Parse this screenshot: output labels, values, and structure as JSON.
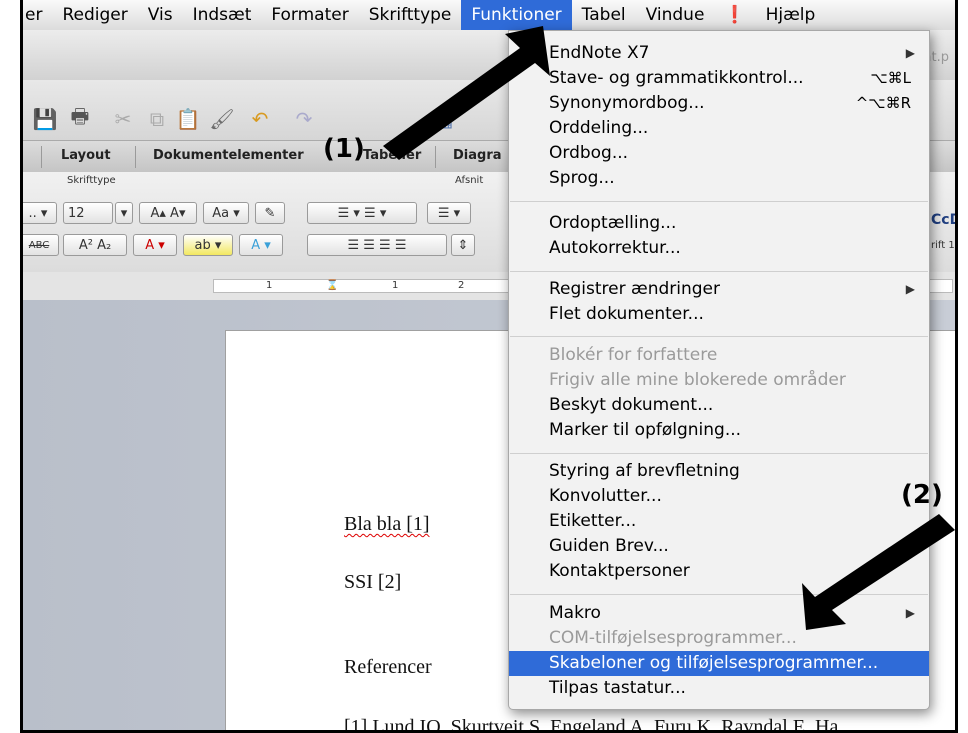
{
  "menubar": {
    "items": [
      "er",
      "Rediger",
      "Vis",
      "Indsæt",
      "Formater",
      "Skrifttype",
      "Funktioner",
      "Tabel",
      "Vindue",
      "Hjælp"
    ],
    "script_icon": "script-menu-icon"
  },
  "window": {
    "filename_partial": "at.p"
  },
  "ribbon": {
    "tabs": [
      "Layout",
      "Dokumentelementer",
      "Tabeller",
      "Diagra"
    ],
    "groups": [
      "Skrifttype",
      "Afsnit"
    ],
    "font_size": "12",
    "style_preview": "CcD",
    "style_name": "rift 1"
  },
  "ruler": {
    "marks": [
      "1",
      "1",
      "2"
    ]
  },
  "document": {
    "lines": [
      "Bla bla [1]",
      "SSI [2]",
      "Referencer",
      "[1] Lund IO, Skurtveit S, Engeland A, Furu K, Ravndal E, Ha"
    ]
  },
  "menu": {
    "title": "Funktioner",
    "items": [
      {
        "label": "EndNote X7",
        "shortcut": "",
        "submenu": true,
        "enabled": true
      },
      {
        "label": "Stave- og grammatikkontrol...",
        "shortcut": "⌥⌘L",
        "submenu": false,
        "enabled": true
      },
      {
        "label": "Synonymordbog...",
        "shortcut": "^⌥⌘R",
        "submenu": false,
        "enabled": true
      },
      {
        "label": "Orddeling...",
        "shortcut": "",
        "submenu": false,
        "enabled": true
      },
      {
        "label": "Ordbog...",
        "shortcut": "",
        "submenu": false,
        "enabled": true
      },
      {
        "label": "Sprog...",
        "shortcut": "",
        "submenu": false,
        "enabled": true
      },
      {
        "label": "Ordoptælling...",
        "shortcut": "",
        "submenu": false,
        "enabled": true
      },
      {
        "label": "Autokorrektur...",
        "shortcut": "",
        "submenu": false,
        "enabled": true
      },
      {
        "label": "Registrer ændringer",
        "shortcut": "",
        "submenu": true,
        "enabled": true
      },
      {
        "label": "Flet dokumenter...",
        "shortcut": "",
        "submenu": false,
        "enabled": true
      },
      {
        "label": "Blokér for forfattere",
        "shortcut": "",
        "submenu": false,
        "enabled": false
      },
      {
        "label": "Frigiv alle mine blokerede områder",
        "shortcut": "",
        "submenu": false,
        "enabled": false
      },
      {
        "label": "Beskyt dokument...",
        "shortcut": "",
        "submenu": false,
        "enabled": true
      },
      {
        "label": "Marker til opfølgning...",
        "shortcut": "",
        "submenu": false,
        "enabled": true
      },
      {
        "label": "Styring af brevfletning",
        "shortcut": "",
        "submenu": false,
        "enabled": true
      },
      {
        "label": "Konvolutter...",
        "shortcut": "",
        "submenu": false,
        "enabled": true
      },
      {
        "label": "Etiketter...",
        "shortcut": "",
        "submenu": false,
        "enabled": true
      },
      {
        "label": "Guiden Brev...",
        "shortcut": "",
        "submenu": false,
        "enabled": true
      },
      {
        "label": "Kontaktpersoner",
        "shortcut": "",
        "submenu": false,
        "enabled": true
      },
      {
        "label": "Makro",
        "shortcut": "",
        "submenu": true,
        "enabled": true
      },
      {
        "label": "COM-tilføjelsesprogrammer...",
        "shortcut": "",
        "submenu": false,
        "enabled": false
      },
      {
        "label": "Skabeloner og tilføjelsesprogrammer...",
        "shortcut": "",
        "submenu": false,
        "enabled": true,
        "highlighted": true
      },
      {
        "label": "Tilpas tastatur...",
        "shortcut": "",
        "submenu": false,
        "enabled": true
      }
    ]
  },
  "annotations": [
    "(1)",
    "(2)"
  ],
  "colors": {
    "highlight": "#2f6bd8",
    "arrow": "#000000"
  }
}
